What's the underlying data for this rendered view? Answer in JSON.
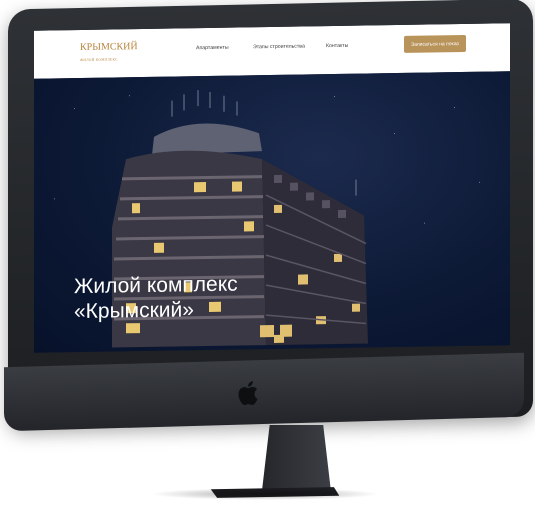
{
  "logo": {
    "name": "КРЫМСКИЙ",
    "tagline": "ЖИЛОЙ КОМПЛЕКС"
  },
  "nav": {
    "items": [
      {
        "label": "Апартаменты"
      },
      {
        "label": "Этапы строительства"
      },
      {
        "label": "Контакты"
      }
    ],
    "cta_label": "Записаться на показ"
  },
  "hero": {
    "title_line1": "Жилой комплекс",
    "title_line2": "«Крымский»"
  },
  "colors": {
    "brand_gold": "#b8863f",
    "cta_bg": "#b8935a",
    "hero_bg": "#0d1a36",
    "monitor_body": "#2b2e32"
  },
  "icons": {
    "device_logo": "apple-logo-icon"
  }
}
